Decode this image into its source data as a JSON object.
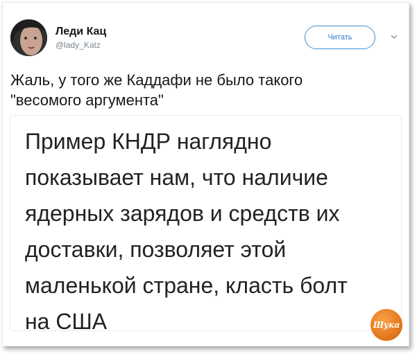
{
  "author": {
    "name": "Леди Кац",
    "handle": "@lady_Katz"
  },
  "follow_button": {
    "label": "Читать"
  },
  "tweet": {
    "text": "Жаль, у того же Каддафи не было такого\n\"весомого аргумента\""
  },
  "quote": {
    "text": "Пример КНДР наглядно\nпоказывает нам, что наличие\nядерных зарядов и средств их\nдоставки, позволяет этой\nмаленькой стране, класть болт\nна США"
  },
  "watermark": {
    "text": "Шука"
  },
  "icons": {
    "menu": "chevron-down-icon"
  },
  "colors": {
    "accent": "#2b7bd1",
    "watermark": "#e07318"
  }
}
